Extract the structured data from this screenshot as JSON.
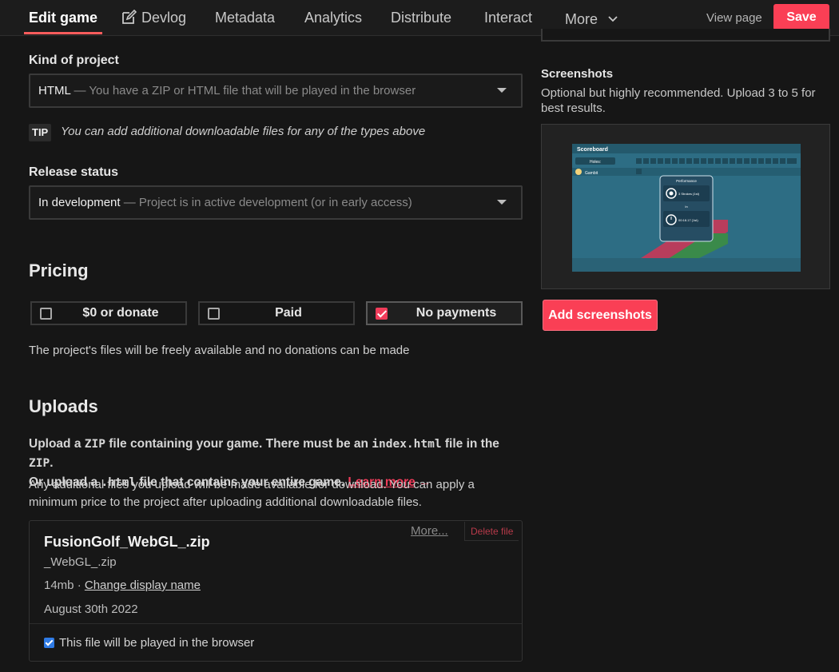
{
  "nav": {
    "tabs": [
      {
        "label": "Edit game",
        "active": true
      },
      {
        "label": "Devlog",
        "icon": "edit-icon"
      },
      {
        "label": "Metadata"
      },
      {
        "label": "Analytics"
      },
      {
        "label": "Distribute"
      },
      {
        "label": "Interact"
      },
      {
        "label": "More",
        "icon": "chevron-down-icon"
      }
    ],
    "view_page": "View page",
    "save": "Save"
  },
  "kind": {
    "label": "Kind of project",
    "value": "HTML",
    "dash": " — ",
    "hint": "You have a ZIP or HTML file that will be played in the browser"
  },
  "tip": {
    "badge": "TIP",
    "text": "You can add additional downloadable files for any of the types above"
  },
  "release": {
    "label": "Release status",
    "value": "In development",
    "dash": " — ",
    "hint": "Project is in active development (or in early access)"
  },
  "pricing": {
    "title": "Pricing",
    "options": [
      {
        "label": "$0 or donate",
        "selected": false
      },
      {
        "label": "Paid",
        "selected": false
      },
      {
        "label": "No payments",
        "selected": true
      }
    ],
    "description": "The project's files will be freely available and no donations can be made"
  },
  "uploads": {
    "title": "Uploads",
    "note_1": "Upload a ",
    "zip_1": "ZIP",
    "note_2": " file containing your game. There must be an ",
    "index_html": "index.html",
    "note_3": " file in the ",
    "zip_2": "ZIP",
    "note_4": ".",
    "note_5": "Or upload a ",
    "html_ext": ".html",
    "note_6": " file that contains your entire game. ",
    "learn_more": "Learn more",
    "arrow": " →",
    "additional": "Any additional files you upload will be made available for download. You can apply a minimum price to the project after uploading additional downloadable files.",
    "file": {
      "name": "FusionGolf_WebGL_.zip",
      "sub": "_WebGL_.zip",
      "size": "14mb",
      "sep": " · ",
      "change_name": "Change display name",
      "date": "August 30th 2022",
      "more": "More...",
      "delete": "Delete file",
      "play_in_browser": "This file will be played in the browser",
      "play_checked": true
    }
  },
  "screenshots": {
    "title": "Screenshots",
    "description": "Optional but highly recommended. Upload 3 to 5 for best results.",
    "add_button": "Add screenshots",
    "thumbnail": {
      "header": "Scoreboard",
      "holes_label": "Holes:",
      "player": "Gambit",
      "card_title": "Performance",
      "strokes": "3 Strokes (1st)",
      "in_label": "In",
      "time": "00:18.17 (1st)"
    }
  },
  "colors": {
    "accent": "#fa3f55",
    "background": "#161616",
    "link": "#f03c5a"
  }
}
